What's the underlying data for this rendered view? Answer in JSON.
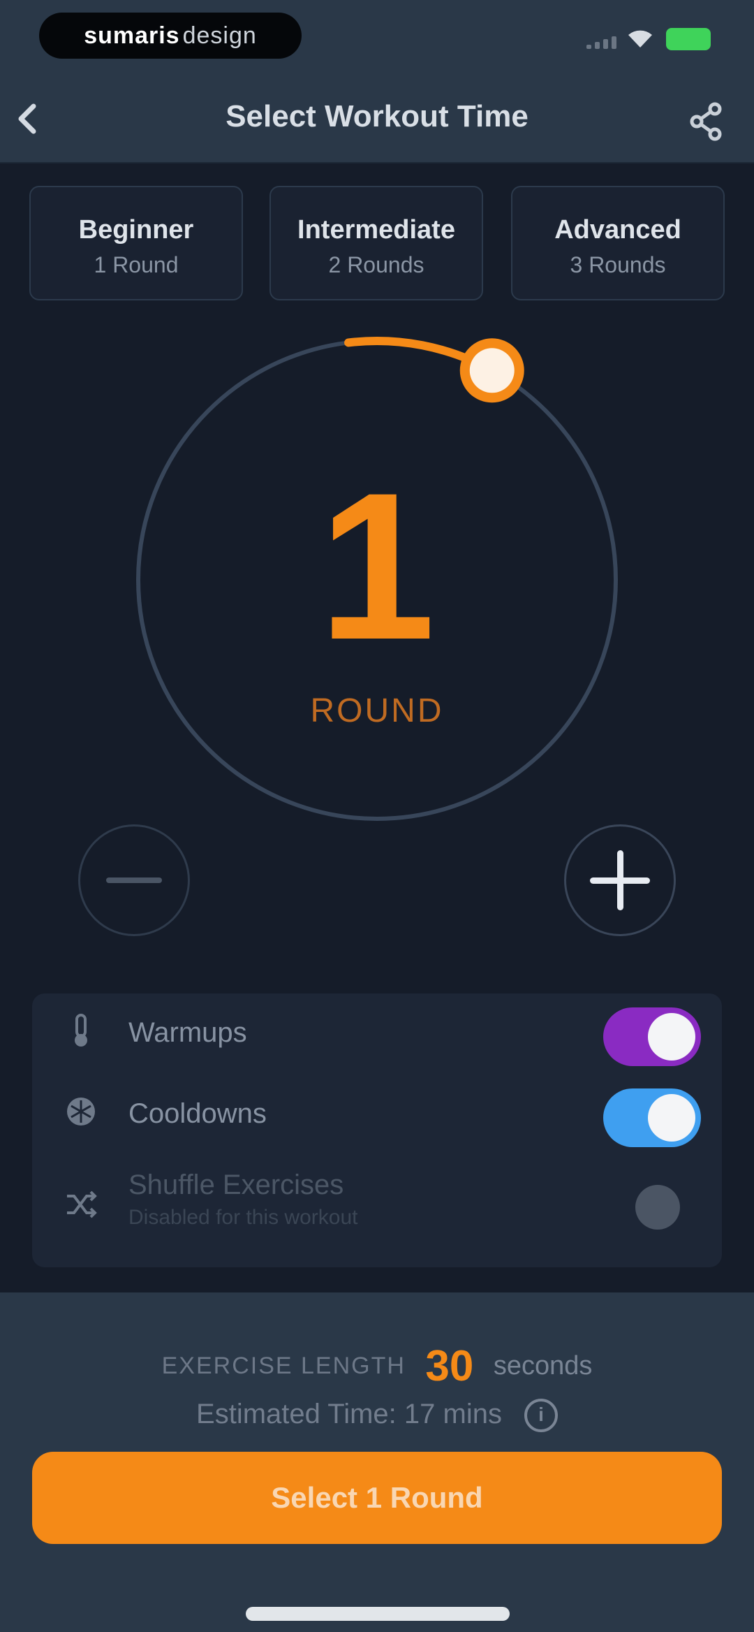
{
  "status_bar": {
    "pill_brand": "sumaris",
    "pill_brand_light": "design",
    "battery_color": "#3fd35a"
  },
  "nav": {
    "title": "Select Workout Time",
    "back_icon": "chevron-left-icon",
    "share_icon": "share-icon"
  },
  "levels": [
    {
      "title": "Beginner",
      "subtitle": "1 Round"
    },
    {
      "title": "Intermediate",
      "subtitle": "2 Rounds"
    },
    {
      "title": "Advanced",
      "subtitle": "3 Rounds"
    }
  ],
  "dial": {
    "value": "1",
    "label": "ROUND",
    "progress_fraction": 0.08,
    "accent_color": "#f58a17"
  },
  "options": [
    {
      "label": "Warmups",
      "icon": "thermometer-icon",
      "enabled": true,
      "color": "#8a2bc2"
    },
    {
      "label": "Cooldowns",
      "icon": "snowflake-icon",
      "enabled": true,
      "color": "#3f9ff0"
    },
    {
      "label": "Shuffle Exercises",
      "sublabel": "Disabled for this workout",
      "icon": "shuffle-icon",
      "enabled": false
    }
  ],
  "bottom": {
    "exercise_length_label": "EXERCISE LENGTH",
    "exercise_length_value": "30",
    "exercise_length_unit": "seconds",
    "estimated_time": "Estimated Time: 17 mins",
    "cta_label": "Select 1 Round"
  }
}
